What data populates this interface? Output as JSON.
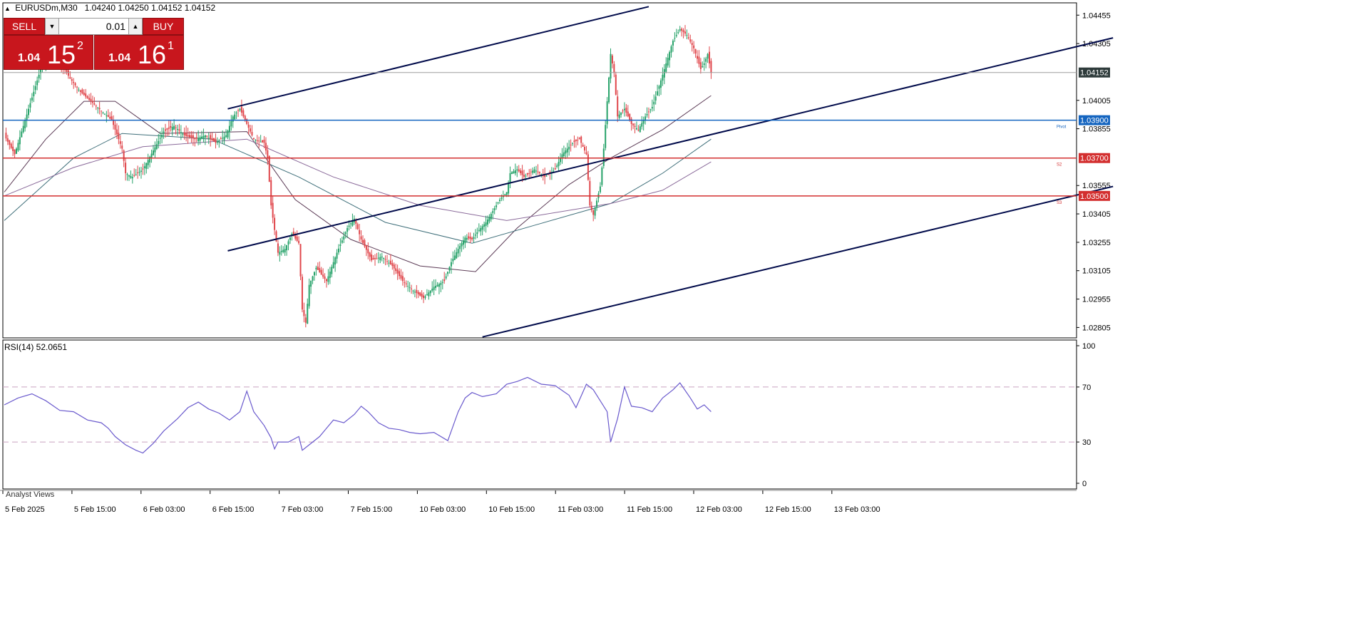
{
  "header": {
    "symbol": "EURUSDm,M30",
    "ohlc": "1.04240 1.04250 1.04152 1.04152"
  },
  "trade_panel": {
    "sell_label": "SELL",
    "buy_label": "BUY",
    "lot": "0.01",
    "sell_big_prefix": "1.04",
    "sell_big_digits": "15",
    "sell_sup": "2",
    "buy_big_prefix": "1.04",
    "buy_big_digits": "16",
    "buy_sup": "1"
  },
  "colors": {
    "bull": "#26a269",
    "bear": "#e0464b",
    "pivot_line": "#1565c0",
    "support_line": "#d32f2f",
    "channel_line": "#000a4a",
    "rsi_line": "#6a5acd"
  },
  "chart_data": [
    {
      "type": "candlestick",
      "title": "EURUSDm,M30",
      "price_axis_ticks": [
        "1.04455",
        "1.04305",
        "1.04005",
        "1.03855",
        "1.03555",
        "1.03405",
        "1.03255",
        "1.03105",
        "1.02955",
        "1.02805"
      ],
      "ylim": [
        1.0275,
        1.0452
      ],
      "time_axis_ticks": [
        "5 Feb 2025",
        "5 Feb 15:00",
        "6 Feb 03:00",
        "6 Feb 15:00",
        "7 Feb 03:00",
        "7 Feb 15:00",
        "10 Feb 03:00",
        "10 Feb 15:00",
        "11 Feb 03:00",
        "11 Feb 15:00",
        "12 Feb 03:00",
        "12 Feb 15:00",
        "13 Feb 03:00"
      ],
      "close_path": [
        [
          0,
          1.0382
        ],
        [
          6,
          1.0372
        ],
        [
          12,
          1.039
        ],
        [
          18,
          1.0408
        ],
        [
          22,
          1.042
        ],
        [
          26,
          1.0425
        ],
        [
          30,
          1.0423
        ],
        [
          34,
          1.0418
        ],
        [
          38,
          1.0412
        ],
        [
          44,
          1.0405
        ],
        [
          50,
          1.04
        ],
        [
          56,
          1.0395
        ],
        [
          62,
          1.039
        ],
        [
          68,
          1.0375
        ],
        [
          70,
          1.0362
        ],
        [
          74,
          1.036
        ],
        [
          80,
          1.0364
        ],
        [
          86,
          1.0374
        ],
        [
          92,
          1.0384
        ],
        [
          98,
          1.0387
        ],
        [
          104,
          1.0382
        ],
        [
          110,
          1.038
        ],
        [
          116,
          1.0382
        ],
        [
          122,
          1.0378
        ],
        [
          128,
          1.0382
        ],
        [
          132,
          1.0392
        ],
        [
          136,
          1.0396
        ],
        [
          140,
          1.0388
        ],
        [
          144,
          1.038
        ],
        [
          150,
          1.0378
        ],
        [
          152,
          1.037
        ],
        [
          154,
          1.0345
        ],
        [
          156,
          1.0332
        ],
        [
          158,
          1.032
        ],
        [
          162,
          1.0322
        ],
        [
          166,
          1.033
        ],
        [
          170,
          1.0325
        ],
        [
          172,
          1.029
        ],
        [
          174,
          1.0283
        ],
        [
          176,
          1.0303
        ],
        [
          180,
          1.0312
        ],
        [
          186,
          1.0305
        ],
        [
          192,
          1.032
        ],
        [
          198,
          1.0333
        ],
        [
          202,
          1.0338
        ],
        [
          206,
          1.0327
        ],
        [
          212,
          1.0316
        ],
        [
          218,
          1.0318
        ],
        [
          224,
          1.0313
        ],
        [
          230,
          1.0305
        ],
        [
          236,
          1.03
        ],
        [
          242,
          1.0296
        ],
        [
          248,
          1.0302
        ],
        [
          254,
          1.0305
        ],
        [
          258,
          1.0315
        ],
        [
          262,
          1.0322
        ],
        [
          266,
          1.0328
        ],
        [
          270,
          1.0327
        ],
        [
          274,
          1.0332
        ],
        [
          278,
          1.0336
        ],
        [
          282,
          1.0342
        ],
        [
          286,
          1.0348
        ],
        [
          290,
          1.0352
        ],
        [
          292,
          1.0362
        ],
        [
          296,
          1.0364
        ],
        [
          300,
          1.036
        ],
        [
          306,
          1.0364
        ],
        [
          312,
          1.036
        ],
        [
          318,
          1.0364
        ],
        [
          322,
          1.0372
        ],
        [
          328,
          1.0378
        ],
        [
          332,
          1.038
        ],
        [
          336,
          1.0372
        ],
        [
          338,
          1.0345
        ],
        [
          340,
          1.034
        ],
        [
          344,
          1.0355
        ],
        [
          346,
          1.0375
        ],
        [
          348,
          1.04
        ],
        [
          350,
          1.0425
        ],
        [
          352,
          1.0415
        ],
        [
          354,
          1.0392
        ],
        [
          358,
          1.0396
        ],
        [
          362,
          1.0388
        ],
        [
          366,
          1.0385
        ],
        [
          370,
          1.0392
        ],
        [
          374,
          1.0397
        ],
        [
          378,
          1.0408
        ],
        [
          382,
          1.042
        ],
        [
          386,
          1.0432
        ],
        [
          390,
          1.0438
        ],
        [
          394,
          1.0435
        ],
        [
          398,
          1.0428
        ],
        [
          402,
          1.0417
        ],
        [
          404,
          1.042
        ],
        [
          406,
          1.0425
        ],
        [
          408,
          1.0415
        ]
      ],
      "moving_averages": [
        {
          "path": [
            [
              0,
              1.0352
            ],
            [
              24,
              1.038
            ],
            [
              46,
              1.04
            ],
            [
              64,
              1.04
            ],
            [
              90,
              1.0383
            ],
            [
              140,
              1.0384
            ],
            [
              168,
              1.0348
            ],
            [
              200,
              1.0327
            ],
            [
              240,
              1.0313
            ],
            [
              272,
              1.031
            ],
            [
              296,
              1.0333
            ],
            [
              326,
              1.0356
            ],
            [
              350,
              1.037
            ],
            [
              380,
              1.0385
            ],
            [
              408,
              1.0403
            ]
          ]
        },
        {
          "path": [
            [
              0,
              1.0337
            ],
            [
              40,
              1.037
            ],
            [
              68,
              1.0383
            ],
            [
              120,
              1.038
            ],
            [
              170,
              1.036
            ],
            [
              220,
              1.0336
            ],
            [
              270,
              1.0325
            ],
            [
              308,
              1.0335
            ],
            [
              350,
              1.0346
            ],
            [
              380,
              1.0362
            ],
            [
              408,
              1.038
            ]
          ]
        },
        {
          "path": [
            [
              0,
              1.035
            ],
            [
              40,
              1.0365
            ],
            [
              80,
              1.0376
            ],
            [
              140,
              1.038
            ],
            [
              190,
              1.036
            ],
            [
              240,
              1.0345
            ],
            [
              290,
              1.0337
            ],
            [
              350,
              1.0346
            ],
            [
              380,
              1.0353
            ],
            [
              408,
              1.0368
            ]
          ]
        }
      ],
      "horizontal_lines": [
        {
          "price": 1.039,
          "label": "1.03900",
          "name": "Pivot"
        },
        {
          "price": 1.037,
          "label": "1.03700",
          "name": "S2"
        },
        {
          "price": 1.035,
          "label": "1.03500",
          "name": "S3"
        },
        {
          "price": 1.04152,
          "label": "1.04152"
        }
      ],
      "channel_lines": [
        {
          "from": [
            129,
            1.0396
          ],
          "to": [
            372,
            1.045
          ]
        },
        {
          "from": [
            129,
            1.0321
          ],
          "to": [
            640,
            1.04335
          ]
        },
        {
          "from": [
            276,
            1.02755
          ],
          "to": [
            640,
            1.0355
          ]
        }
      ]
    },
    {
      "type": "line",
      "title": "RSI(14) 52.0651",
      "ylim": [
        0,
        100
      ],
      "ticks": [
        "100",
        "70",
        "30",
        "0"
      ],
      "levels": [
        70,
        30
      ],
      "path": [
        [
          0,
          57
        ],
        [
          8,
          62
        ],
        [
          16,
          65
        ],
        [
          24,
          60
        ],
        [
          32,
          53
        ],
        [
          40,
          52
        ],
        [
          48,
          46
        ],
        [
          56,
          44
        ],
        [
          60,
          40
        ],
        [
          64,
          34
        ],
        [
          70,
          28
        ],
        [
          76,
          24
        ],
        [
          80,
          22
        ],
        [
          86,
          29
        ],
        [
          92,
          38
        ],
        [
          100,
          47
        ],
        [
          106,
          55
        ],
        [
          112,
          59
        ],
        [
          118,
          54
        ],
        [
          124,
          51
        ],
        [
          130,
          46
        ],
        [
          136,
          52
        ],
        [
          140,
          67
        ],
        [
          144,
          52
        ],
        [
          150,
          42
        ],
        [
          154,
          33
        ],
        [
          156,
          25
        ],
        [
          158,
          30
        ],
        [
          164,
          30
        ],
        [
          170,
          34
        ],
        [
          172,
          24
        ],
        [
          176,
          28
        ],
        [
          182,
          34
        ],
        [
          186,
          40
        ],
        [
          190,
          46
        ],
        [
          196,
          44
        ],
        [
          202,
          50
        ],
        [
          206,
          56
        ],
        [
          210,
          52
        ],
        [
          216,
          44
        ],
        [
          222,
          40
        ],
        [
          228,
          39
        ],
        [
          234,
          37
        ],
        [
          240,
          36
        ],
        [
          248,
          37
        ],
        [
          256,
          31
        ],
        [
          262,
          52
        ],
        [
          266,
          62
        ],
        [
          270,
          66
        ],
        [
          276,
          63
        ],
        [
          284,
          65
        ],
        [
          290,
          72
        ],
        [
          296,
          74
        ],
        [
          302,
          77
        ],
        [
          310,
          72
        ],
        [
          318,
          71
        ],
        [
          326,
          64
        ],
        [
          330,
          55
        ],
        [
          336,
          72
        ],
        [
          340,
          68
        ],
        [
          344,
          60
        ],
        [
          348,
          52
        ],
        [
          350,
          30
        ],
        [
          354,
          47
        ],
        [
          358,
          70
        ],
        [
          362,
          56
        ],
        [
          368,
          55
        ],
        [
          374,
          52
        ],
        [
          380,
          62
        ],
        [
          386,
          68
        ],
        [
          390,
          73
        ],
        [
          396,
          62
        ],
        [
          400,
          54
        ],
        [
          404,
          57
        ],
        [
          408,
          52
        ]
      ]
    }
  ],
  "indicator": {
    "rsi_label": "RSI(14) 52.0651"
  },
  "bottom_tab": {
    "label": "Analyst Views"
  }
}
